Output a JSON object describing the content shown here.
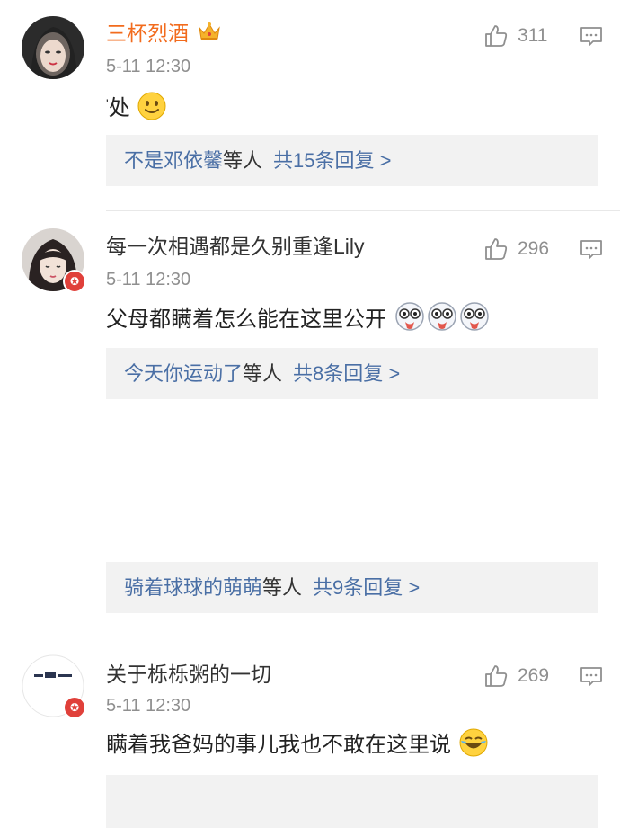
{
  "comments": [
    {
      "username": "三杯烈酒",
      "time": "5-11 12:30",
      "text": "处",
      "likes": "311",
      "reply": {
        "name": "不是邓依馨",
        "middle": "等人",
        "count": "共15条回复 >"
      }
    },
    {
      "username": "每一次相遇都是久别重逢Lily",
      "time": "5-11 12:30",
      "text": "父母都瞒着怎么能在这里公开",
      "likes": "296",
      "reply": {
        "name": "今天你运动了",
        "middle": "等人",
        "count": "共8条回复 >"
      }
    },
    {
      "reply": {
        "name": "骑着球球的萌萌",
        "middle": "等人",
        "count": "共9条回复 >"
      }
    },
    {
      "username": "关于栎栎粥的一切",
      "time": "5-11 12:30",
      "text": "瞒着我爸妈的事儿我也不敢在这里说",
      "likes": "269"
    }
  ],
  "colors": {
    "username_vip": "#f26b1d",
    "link": "#4a6fa5",
    "reply_bg": "#f2f2f2",
    "verify_badge": "#e0403a"
  },
  "icons": [
    "crown-icon",
    "thumbs-up-icon",
    "comment-icon",
    "smile-emoji",
    "ghost-emoji",
    "laugh-cry-emoji",
    "verified-badge-icon"
  ]
}
